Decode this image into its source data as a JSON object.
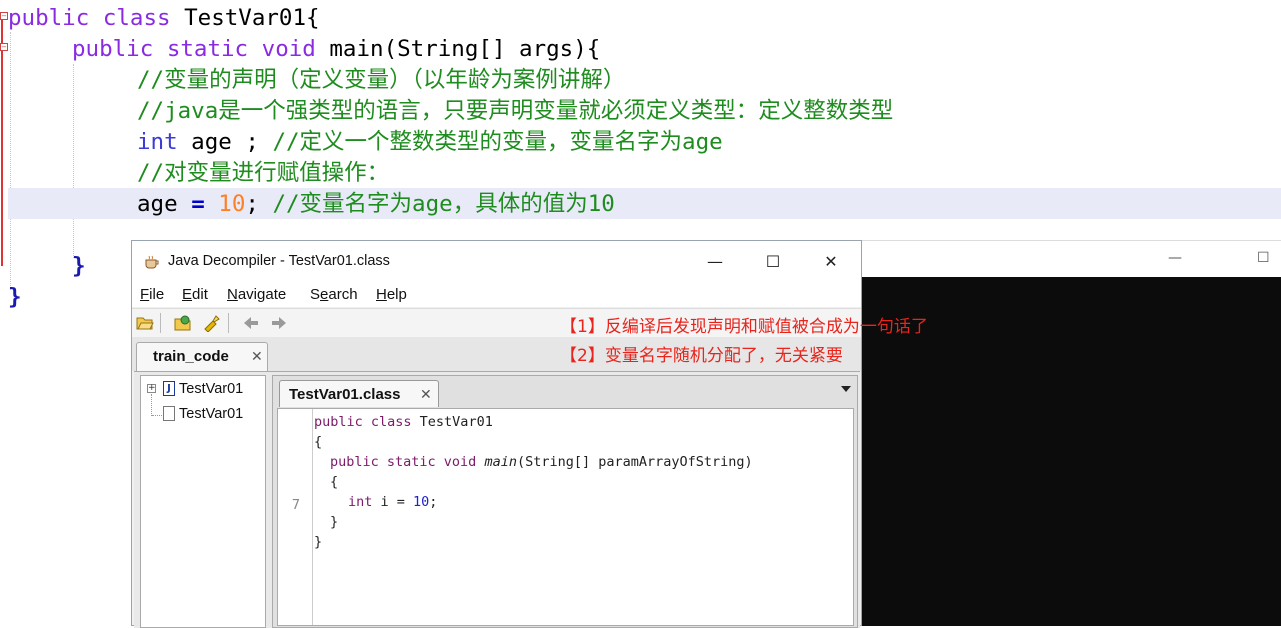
{
  "editor": {
    "lines": {
      "l1_kw": "public class ",
      "l1_rest": "TestVar01{",
      "l2_kw": "public static void ",
      "l2_rest": "main(String[] args){",
      "l3": "//变量的声明（定义变量）（以年龄为案例讲解）",
      "l4": "//java是一个强类型的语言，只要声明变量就必须定义类型：定义整数类型",
      "l5_kw": "int",
      "l5_code": " age ; ",
      "l5_cm": "//定义一个整数类型的变量，变量名字为age",
      "l6": "//对变量进行赋值操作：",
      "l7_code": "age ",
      "l7_op": "=",
      "l7_num": " 10",
      "l7_semi": "; ",
      "l7_cm": "//变量名字为age，具体的值为10",
      "l9": "}",
      "l10": "}"
    }
  },
  "decompiler": {
    "title": "Java Decompiler - TestVar01.class",
    "window_buttons": {
      "minimize": "—",
      "maximize": "☐",
      "close": "✕"
    },
    "menu": {
      "file": {
        "mnemonic": "F",
        "rest": "ile"
      },
      "edit": {
        "mnemonic": "E",
        "rest": "dit"
      },
      "navigate": {
        "mnemonic": "N",
        "rest": "avigate"
      },
      "search": {
        "pre": "S",
        "mnemonic": "e",
        "rest": "arch"
      },
      "help": {
        "mnemonic": "H",
        "rest": "elp"
      }
    },
    "outer_tab": "train_code",
    "tree": [
      "TestVar01",
      "TestVar01"
    ],
    "inner_tab": "TestVar01.class",
    "code": {
      "line1_kw": "public class ",
      "line1_rest": "TestVar01",
      "line2": "{",
      "line3_kw": "public static void ",
      "line3_name": "main",
      "line3_rest": "(String[] paramArrayOfString)",
      "line4": "{",
      "line5_kw": "int ",
      "line5_mid": "i = ",
      "line5_num": "10",
      "line5_end": ";",
      "line6": "}",
      "line7": "}",
      "line_number": "7"
    }
  },
  "annotations": {
    "a1": "【1】反编译后发现声明和赋值被合成为一句话了",
    "a2": "【2】变量名字随机分配了，无关紧要"
  },
  "console": {
    "minimize": "—",
    "maximize": "☐"
  },
  "colors": {
    "annotation": "#e8241c",
    "keyword": "#8a2be2",
    "comment": "#1e8c1e",
    "number": "#ff7f24"
  }
}
